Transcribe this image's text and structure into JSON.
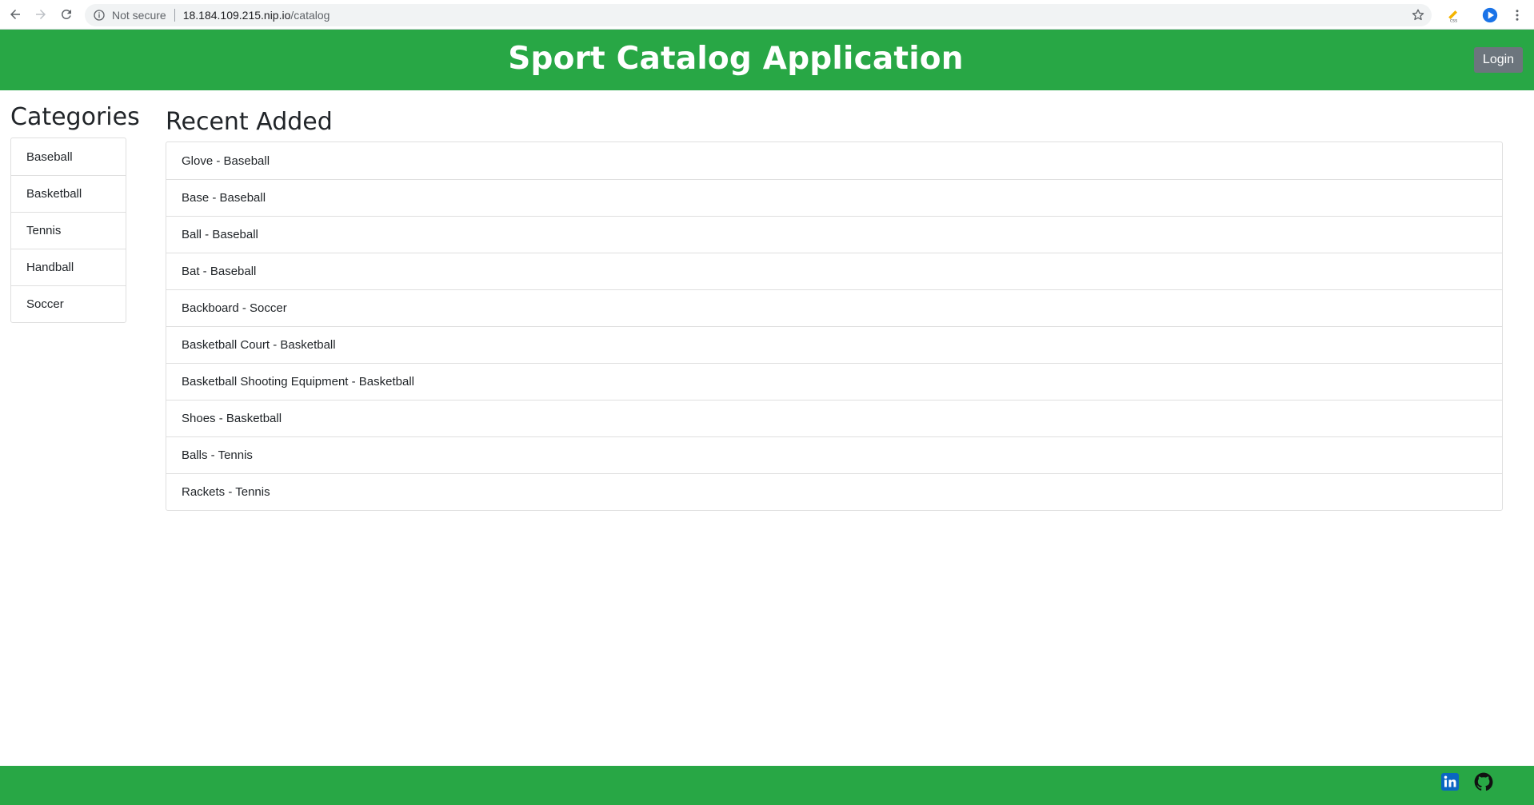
{
  "browser": {
    "security_label": "Not secure",
    "url_host": "18.184.109.215.nip.io",
    "url_path": "/catalog"
  },
  "header": {
    "title": "Sport Catalog Application",
    "login_label": "Login"
  },
  "sidebar": {
    "heading": "Categories",
    "items": [
      {
        "label": "Baseball"
      },
      {
        "label": "Basketball"
      },
      {
        "label": "Tennis"
      },
      {
        "label": "Handball"
      },
      {
        "label": "Soccer"
      }
    ]
  },
  "main": {
    "heading": "Recent Added",
    "items": [
      {
        "label": "Glove - Baseball"
      },
      {
        "label": "Base - Baseball"
      },
      {
        "label": "Ball - Baseball"
      },
      {
        "label": "Bat - Baseball"
      },
      {
        "label": "Backboard - Soccer"
      },
      {
        "label": "Basketball Court - Basketball"
      },
      {
        "label": "Basketball Shooting Equipment - Basketball"
      },
      {
        "label": "Shoes - Basketball"
      },
      {
        "label": "Balls - Tennis"
      },
      {
        "label": "Rackets - Tennis"
      }
    ]
  },
  "footer": {
    "icons": [
      "linkedin-icon",
      "github-icon"
    ]
  },
  "colors": {
    "brand_green": "#28a745",
    "login_button": "#6c757d",
    "linkedin_blue": "#0a66c2"
  }
}
